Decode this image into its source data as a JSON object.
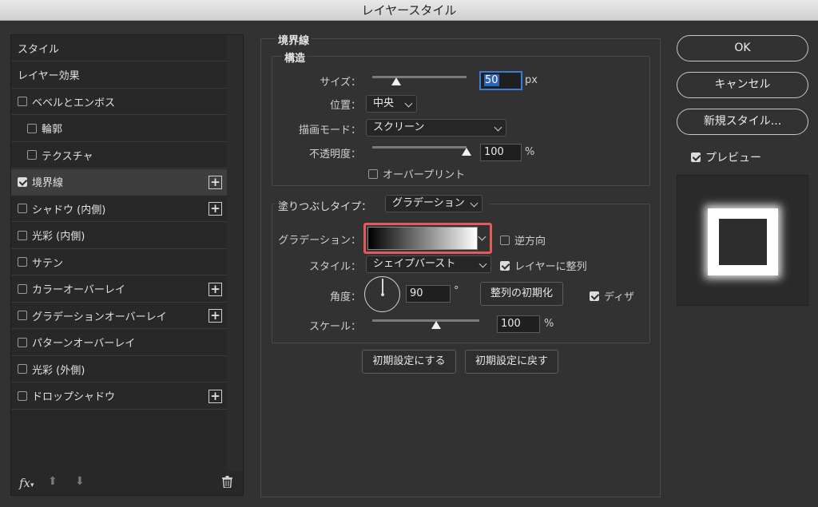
{
  "window": {
    "title": "レイヤースタイル"
  },
  "left_list": {
    "items": [
      {
        "label": "スタイル",
        "checkbox": false,
        "checked": false,
        "plus": false,
        "indent": 0,
        "selected": false
      },
      {
        "label": "レイヤー効果",
        "checkbox": false,
        "checked": false,
        "plus": false,
        "indent": 0,
        "selected": false
      },
      {
        "label": "ベベルとエンボス",
        "checkbox": true,
        "checked": false,
        "plus": false,
        "indent": 0,
        "selected": false
      },
      {
        "label": "輪郭",
        "checkbox": true,
        "checked": false,
        "plus": false,
        "indent": 1,
        "selected": false
      },
      {
        "label": "テクスチャ",
        "checkbox": true,
        "checked": false,
        "plus": false,
        "indent": 1,
        "selected": false
      },
      {
        "label": "境界線",
        "checkbox": true,
        "checked": true,
        "plus": true,
        "indent": 0,
        "selected": true
      },
      {
        "label": "シャドウ (内側)",
        "checkbox": true,
        "checked": false,
        "plus": true,
        "indent": 0,
        "selected": false
      },
      {
        "label": "光彩 (内側)",
        "checkbox": true,
        "checked": false,
        "plus": false,
        "indent": 0,
        "selected": false
      },
      {
        "label": "サテン",
        "checkbox": true,
        "checked": false,
        "plus": false,
        "indent": 0,
        "selected": false
      },
      {
        "label": "カラーオーバーレイ",
        "checkbox": true,
        "checked": false,
        "plus": true,
        "indent": 0,
        "selected": false
      },
      {
        "label": "グラデーションオーバーレイ",
        "checkbox": true,
        "checked": false,
        "plus": true,
        "indent": 0,
        "selected": false
      },
      {
        "label": "パターンオーバーレイ",
        "checkbox": true,
        "checked": false,
        "plus": false,
        "indent": 0,
        "selected": false
      },
      {
        "label": "光彩 (外側)",
        "checkbox": true,
        "checked": false,
        "plus": false,
        "indent": 0,
        "selected": false
      },
      {
        "label": "ドロップシャドウ",
        "checkbox": true,
        "checked": false,
        "plus": true,
        "indent": 0,
        "selected": false
      }
    ],
    "footer": {
      "fx_label": "fx",
      "icons": [
        "fx-icon",
        "arrow-up-icon",
        "arrow-down-icon",
        "trash-icon"
      ]
    }
  },
  "stroke": {
    "section_title": "境界線",
    "structure": {
      "title": "構造",
      "size_label": "サイズ：",
      "size_value": "50",
      "size_unit": "px",
      "size_slider_fraction": 0.25,
      "position_label": "位置：",
      "position_value": "中央",
      "blend_label": "描画モード：",
      "blend_value": "スクリーン",
      "opacity_label": "不透明度：",
      "opacity_value": "100",
      "opacity_unit": "%",
      "opacity_slider_fraction": 1.0,
      "overprint_label": "オーバープリント",
      "overprint_checked": false
    },
    "fill": {
      "fill_type_label": "塗りつぶしタイプ：",
      "fill_type_value": "グラデーション",
      "gradient_label": "グラデーション：",
      "gradient_colors": [
        "#000000",
        "#ffffff"
      ],
      "gradient_highlight": "#e25a5a",
      "reverse_label": "逆方向",
      "reverse_checked": false,
      "style_label": "スタイル：",
      "style_value": "シェイプバースト",
      "align_label": "レイヤーに整列",
      "align_checked": true,
      "angle_label": "角度：",
      "angle_value": "90",
      "angle_unit": "°",
      "reset_align_label": "整列の初期化",
      "dither_label": "ディザ",
      "dither_checked": true,
      "scale_label": "スケール：",
      "scale_value": "100",
      "scale_unit": "%",
      "scale_slider_fraction": 0.6
    },
    "make_default_label": "初期設定にする",
    "reset_default_label": "初期設定に戻す"
  },
  "right": {
    "ok_label": "OK",
    "cancel_label": "キャンセル",
    "new_style_label": "新規スタイル...",
    "preview_label": "プレビュー",
    "preview_checked": true
  }
}
